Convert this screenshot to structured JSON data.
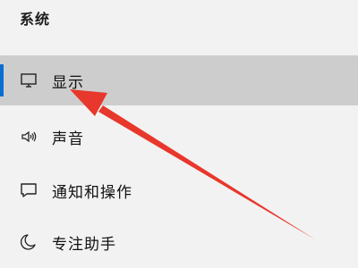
{
  "header": {
    "title": "系统"
  },
  "nav": [
    {
      "label": "显示",
      "icon": "monitor-icon",
      "active": true
    },
    {
      "label": "声音",
      "icon": "speaker-icon",
      "active": false
    },
    {
      "label": "通知和操作",
      "icon": "notification-icon",
      "active": false
    },
    {
      "label": "专注助手",
      "icon": "moon-icon",
      "active": false
    }
  ],
  "colors": {
    "accent": "#0a6ed1",
    "selected_bg": "#cdcdcd",
    "page_bg": "#f2f2f2",
    "arrow": "#e8372c"
  }
}
